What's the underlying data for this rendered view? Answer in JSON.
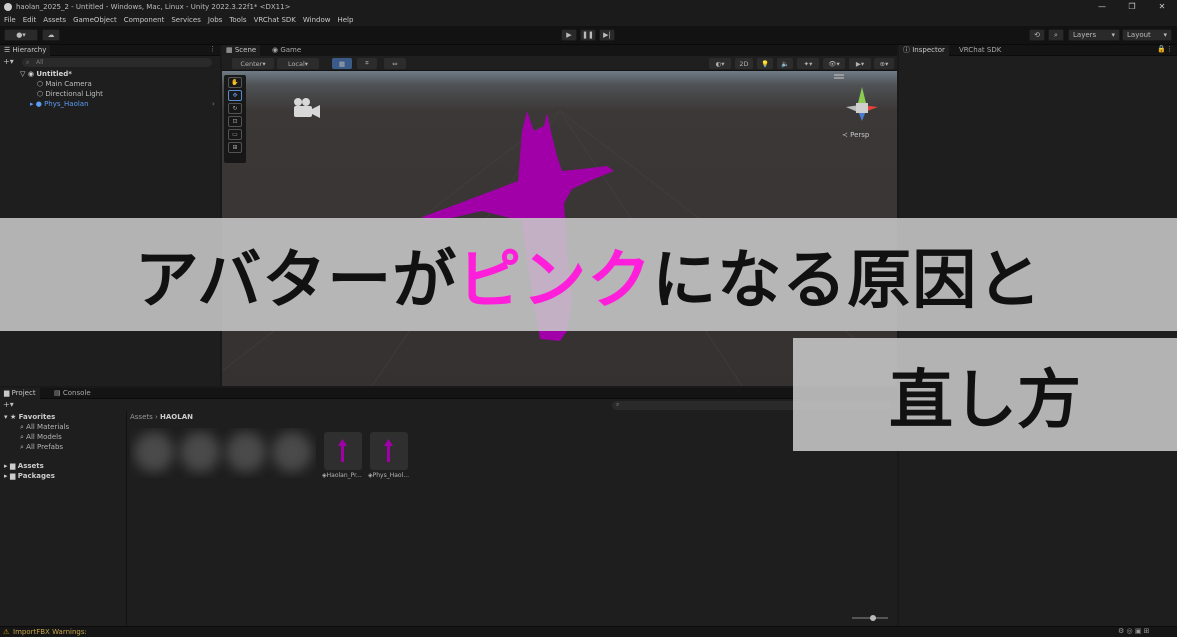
{
  "window": {
    "title": "haolan_2025_2 - Untitled - Windows, Mac, Linux - Unity 2022.3.22f1* <DX11>",
    "minimize": "—",
    "maximize": "❐",
    "close": "✕"
  },
  "menu": [
    "File",
    "Edit",
    "Assets",
    "GameObject",
    "Component",
    "Services",
    "Jobs",
    "Tools",
    "VRChat SDK",
    "Window",
    "Help"
  ],
  "toolbar": {
    "play": "▶",
    "pause": "❚❚",
    "step": "▶|",
    "layers": "Layers",
    "layout": "Layout"
  },
  "hierarchy": {
    "tab": "Hierarchy",
    "search_placeholder": "All",
    "scene": "Untitled*",
    "items": [
      "Main Camera",
      "Directional Light",
      "Phys_Haolan"
    ]
  },
  "scene": {
    "tabs": [
      "Scene",
      "Game"
    ],
    "pivot": "Center",
    "space": "Local",
    "mode_2d": "2D",
    "persp": "Persp"
  },
  "inspector": {
    "tabs": [
      "Inspector",
      "VRChat SDK"
    ]
  },
  "project": {
    "tabs": [
      "Project",
      "Console"
    ],
    "favorites": "Favorites",
    "fav_items": [
      "All Materials",
      "All Models",
      "All Prefabs"
    ],
    "roots": [
      "Assets",
      "Packages"
    ],
    "breadcrumb_root": "Assets",
    "breadcrumb_current": "HAOLAN",
    "assets": [
      "Haolan_Pr...",
      "Phys_Haol..."
    ]
  },
  "status": {
    "warning": "ImportFBX Warnings:"
  },
  "banner": {
    "line1_a": "アバターが",
    "line1_pink": "ピンク",
    "line1_b": "になる原因と",
    "line2": "直し方"
  },
  "colors": {
    "pink": "#ff1ed9",
    "magenta_avatar": "#a100a8"
  }
}
